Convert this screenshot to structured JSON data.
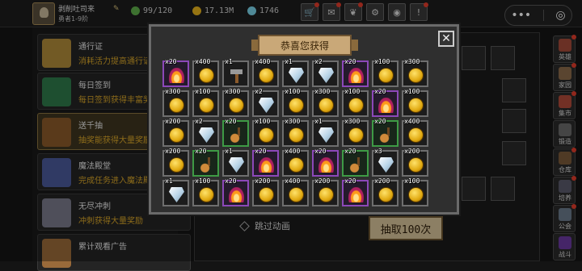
{
  "user": {
    "name": "剥削吐司来",
    "level_text": "勇者1-9阶"
  },
  "resources": [
    {
      "icon": "stamina-icon",
      "value": "99/120",
      "color": "#5fae4a"
    },
    {
      "icon": "gold-icon",
      "value": "17.13M",
      "color": "#e6b21c"
    },
    {
      "icon": "gem-icon",
      "value": "1746",
      "color": "#7ad3e8"
    }
  ],
  "toolbar": [
    {
      "icon": "shop-cart-icon",
      "glyph": "🛒"
    },
    {
      "icon": "mail-icon",
      "glyph": "✉"
    },
    {
      "icon": "wing-icon",
      "glyph": "❦"
    },
    {
      "icon": "settings-icon",
      "glyph": "⚙"
    },
    {
      "icon": "globe-icon",
      "glyph": "◉"
    },
    {
      "icon": "notice-icon",
      "glyph": "!"
    }
  ],
  "capsule": {
    "more": "•••",
    "exit": "◎"
  },
  "left_menu": [
    {
      "title": "通行证",
      "desc": "消耗活力提高通行证",
      "icon": "chalice-icon",
      "color": "#b08a3a"
    },
    {
      "title": "每日签到",
      "desc": "每日签到获得丰富奖",
      "icon": "book-icon",
      "color": "#2e7a4a"
    },
    {
      "title": "送千抽",
      "desc": "抽奖能获得大量奖励",
      "icon": "chest-icon",
      "color": "#8a5a2a"
    },
    {
      "title": "魔法殿堂",
      "desc": "完成任务进入魔法殿",
      "icon": "crystal-icon",
      "color": "#4a5a9a"
    },
    {
      "title": "无尽冲刺",
      "desc": "冲刺获得大量奖励",
      "icon": "warrior-icon",
      "color": "#7a7a8a"
    },
    {
      "title": "累计观看广告",
      "desc": "",
      "icon": "tv-icon",
      "color": "#9a6a3a"
    }
  ],
  "right_nav": [
    {
      "label": "英雄",
      "icon": "hero-icon",
      "color": "#a44a3a"
    },
    {
      "label": "家园",
      "icon": "home-icon",
      "color": "#8a6a4a"
    },
    {
      "label": "集市",
      "icon": "market-icon",
      "color": "#b04a3a"
    },
    {
      "label": "锻造",
      "icon": "forge-icon",
      "color": "#6a6a6a"
    },
    {
      "label": "仓库",
      "icon": "storage-icon",
      "color": "#7a5a3a"
    },
    {
      "label": "培养",
      "icon": "train-icon",
      "color": "#5a5a6a"
    },
    {
      "label": "公会",
      "icon": "guild-icon",
      "color": "#6a7a8a"
    },
    {
      "label": "战斗",
      "icon": "battle-icon",
      "color": "#6a3aa0"
    }
  ],
  "center": {
    "skip_label": "跳过动画",
    "draw_button": "抽取100次"
  },
  "modal": {
    "title": "恭喜您获得",
    "close": "✕",
    "rows": [
      [
        {
          "q": "x20",
          "t": "flame",
          "r": "purple"
        },
        {
          "q": "x400",
          "t": "coin",
          "r": "grey"
        },
        {
          "q": "x1",
          "t": "hammer",
          "r": "grey"
        },
        {
          "q": "x400",
          "t": "coin",
          "r": "grey"
        },
        {
          "q": "x1",
          "t": "gem",
          "r": "grey"
        },
        {
          "q": "x2",
          "t": "gem",
          "r": "grey"
        },
        {
          "q": "x20",
          "t": "flame",
          "r": "purple"
        },
        {
          "q": "x100",
          "t": "coin",
          "r": "grey"
        },
        {
          "q": "x300",
          "t": "coin",
          "r": "grey"
        }
      ],
      [
        {
          "q": "x300",
          "t": "coin",
          "r": "grey"
        },
        {
          "q": "x100",
          "t": "coin",
          "r": "grey"
        },
        {
          "q": "x300",
          "t": "coin",
          "r": "grey"
        },
        {
          "q": "x2",
          "t": "gem",
          "r": "grey"
        },
        {
          "q": "x100",
          "t": "coin",
          "r": "grey"
        },
        {
          "q": "x300",
          "t": "coin",
          "r": "grey"
        },
        {
          "q": "x100",
          "t": "coin",
          "r": "grey"
        },
        {
          "q": "x20",
          "t": "flame",
          "r": "purple"
        },
        {
          "q": "x100",
          "t": "coin",
          "r": "grey"
        }
      ],
      [
        {
          "q": "x200",
          "t": "coin",
          "r": "grey"
        },
        {
          "q": "x2",
          "t": "gem",
          "r": "grey"
        },
        {
          "q": "x20",
          "t": "guitar",
          "r": "green"
        },
        {
          "q": "x100",
          "t": "coin",
          "r": "grey"
        },
        {
          "q": "x300",
          "t": "coin",
          "r": "grey"
        },
        {
          "q": "x1",
          "t": "gem",
          "r": "grey"
        },
        {
          "q": "x300",
          "t": "coin",
          "r": "grey"
        },
        {
          "q": "x20",
          "t": "guitar",
          "r": "green"
        },
        {
          "q": "x400",
          "t": "coin",
          "r": "grey"
        }
      ],
      [
        {
          "q": "x200",
          "t": "coin",
          "r": "grey"
        },
        {
          "q": "x20",
          "t": "guitar",
          "r": "green"
        },
        {
          "q": "x1",
          "t": "gem",
          "r": "grey"
        },
        {
          "q": "x20",
          "t": "flame",
          "r": "purple"
        },
        {
          "q": "x400",
          "t": "coin",
          "r": "grey"
        },
        {
          "q": "x20",
          "t": "flame",
          "r": "purple"
        },
        {
          "q": "x20",
          "t": "guitar",
          "r": "green"
        },
        {
          "q": "x3",
          "t": "gem",
          "r": "grey"
        },
        {
          "q": "x200",
          "t": "coin",
          "r": "grey"
        }
      ],
      [
        {
          "q": "x1",
          "t": "gem",
          "r": "grey"
        },
        {
          "q": "x100",
          "t": "coin",
          "r": "grey"
        },
        {
          "q": "x20",
          "t": "flame",
          "r": "purple"
        },
        {
          "q": "x200",
          "t": "coin",
          "r": "grey"
        },
        {
          "q": "x400",
          "t": "coin",
          "r": "grey"
        },
        {
          "q": "x200",
          "t": "coin",
          "r": "grey"
        },
        {
          "q": "x20",
          "t": "flame",
          "r": "purple"
        },
        {
          "q": "x200",
          "t": "coin",
          "r": "grey"
        },
        {
          "q": "x100",
          "t": "coin",
          "r": "grey"
        }
      ]
    ]
  }
}
